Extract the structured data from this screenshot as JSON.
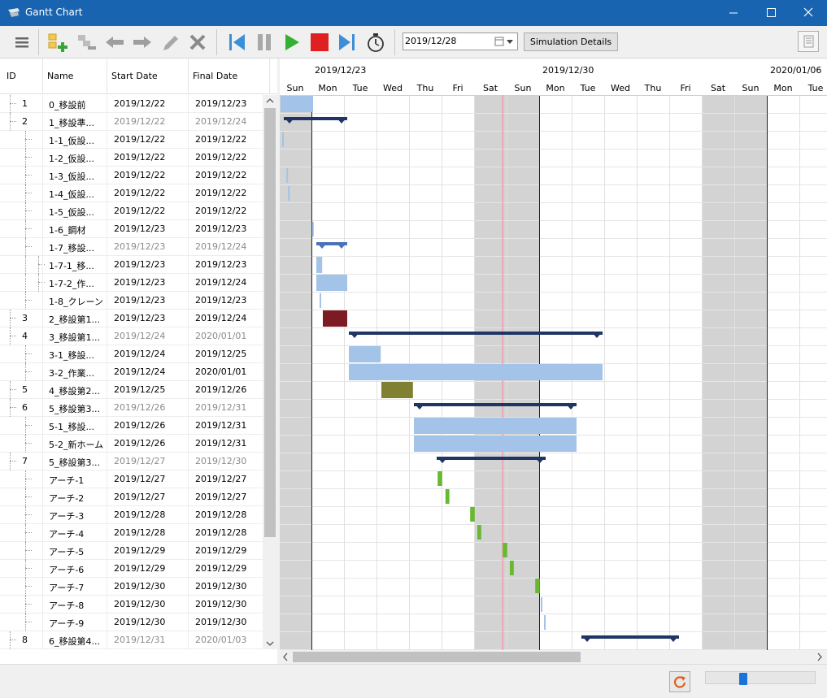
{
  "window": {
    "title": "Gantt Chart",
    "minimize_icon": "minimize-icon",
    "maximize_icon": "maximize-icon",
    "close_icon": "close-icon"
  },
  "toolbar": {
    "menu_icon": "hamburger-menu-icon",
    "add_task_icon": "add-task-icon",
    "add_subtask_icon": "add-subtask-icon",
    "outdent_icon": "arrow-left-icon",
    "indent_icon": "arrow-right-icon",
    "edit_icon": "pencil-icon",
    "delete_icon": "delete-x-icon",
    "skip_start_icon": "skip-to-start-icon",
    "pause_icon": "pause-icon",
    "play_icon": "play-icon",
    "stop_icon": "stop-icon",
    "skip_end_icon": "skip-to-end-icon",
    "timer_icon": "stopwatch-icon",
    "date_value": "2019/12/28",
    "simulation_details_label": "Simulation Details",
    "table_view_icon": "table-view-icon"
  },
  "grid": {
    "headers": {
      "id": "ID",
      "name": "Name",
      "start": "Start Date",
      "final": "Final Date"
    },
    "rows": [
      {
        "id": "1",
        "name": "0_移設前",
        "start": "2019/12/22",
        "final": "2019/12/23",
        "grey": false,
        "level": 0
      },
      {
        "id": "2",
        "name": "1_移設準...",
        "start": "2019/12/22",
        "final": "2019/12/24",
        "grey": true,
        "level": 0
      },
      {
        "id": "",
        "name": "1-1_仮設...",
        "start": "2019/12/22",
        "final": "2019/12/22",
        "grey": false,
        "level": 1
      },
      {
        "id": "",
        "name": "1-2_仮設...",
        "start": "2019/12/22",
        "final": "2019/12/22",
        "grey": false,
        "level": 1
      },
      {
        "id": "",
        "name": "1-3_仮設...",
        "start": "2019/12/22",
        "final": "2019/12/22",
        "grey": false,
        "level": 1
      },
      {
        "id": "",
        "name": "1-4_仮設...",
        "start": "2019/12/22",
        "final": "2019/12/22",
        "grey": false,
        "level": 1
      },
      {
        "id": "",
        "name": "1-5_仮設...",
        "start": "2019/12/22",
        "final": "2019/12/22",
        "grey": false,
        "level": 1
      },
      {
        "id": "",
        "name": "1-6_鋼材",
        "start": "2019/12/23",
        "final": "2019/12/23",
        "grey": false,
        "level": 1
      },
      {
        "id": "",
        "name": "1-7_移設...",
        "start": "2019/12/23",
        "final": "2019/12/24",
        "grey": true,
        "level": 1
      },
      {
        "id": "",
        "name": "1-7-1_移...",
        "start": "2019/12/23",
        "final": "2019/12/23",
        "grey": false,
        "level": 2
      },
      {
        "id": "",
        "name": "1-7-2_作...",
        "start": "2019/12/23",
        "final": "2019/12/24",
        "grey": false,
        "level": 2
      },
      {
        "id": "",
        "name": "1-8_クレーン",
        "start": "2019/12/23",
        "final": "2019/12/23",
        "grey": false,
        "level": 1
      },
      {
        "id": "3",
        "name": "2_移設第1...",
        "start": "2019/12/23",
        "final": "2019/12/24",
        "grey": false,
        "level": 0
      },
      {
        "id": "4",
        "name": "3_移設第1...",
        "start": "2019/12/24",
        "final": "2020/01/01",
        "grey": true,
        "level": 0
      },
      {
        "id": "",
        "name": "3-1_移設...",
        "start": "2019/12/24",
        "final": "2019/12/25",
        "grey": false,
        "level": 1
      },
      {
        "id": "",
        "name": "3-2_作業...",
        "start": "2019/12/24",
        "final": "2020/01/01",
        "grey": false,
        "level": 1
      },
      {
        "id": "5",
        "name": "4_移設第2...",
        "start": "2019/12/25",
        "final": "2019/12/26",
        "grey": false,
        "level": 0
      },
      {
        "id": "6",
        "name": "5_移設第3...",
        "start": "2019/12/26",
        "final": "2019/12/31",
        "grey": true,
        "level": 0
      },
      {
        "id": "",
        "name": "5-1_移設...",
        "start": "2019/12/26",
        "final": "2019/12/31",
        "grey": false,
        "level": 1
      },
      {
        "id": "",
        "name": "5-2_新ホーム",
        "start": "2019/12/26",
        "final": "2019/12/31",
        "grey": false,
        "level": 1
      },
      {
        "id": "7",
        "name": "5_移設第3...",
        "start": "2019/12/27",
        "final": "2019/12/30",
        "grey": true,
        "level": 0
      },
      {
        "id": "",
        "name": "アーチ-1",
        "start": "2019/12/27",
        "final": "2019/12/27",
        "grey": false,
        "level": 1
      },
      {
        "id": "",
        "name": "アーチ-2",
        "start": "2019/12/27",
        "final": "2019/12/27",
        "grey": false,
        "level": 1
      },
      {
        "id": "",
        "name": "アーチ-3",
        "start": "2019/12/28",
        "final": "2019/12/28",
        "grey": false,
        "level": 1
      },
      {
        "id": "",
        "name": "アーチ-4",
        "start": "2019/12/28",
        "final": "2019/12/28",
        "grey": false,
        "level": 1
      },
      {
        "id": "",
        "name": "アーチ-5",
        "start": "2019/12/29",
        "final": "2019/12/29",
        "grey": false,
        "level": 1
      },
      {
        "id": "",
        "name": "アーチ-6",
        "start": "2019/12/29",
        "final": "2019/12/29",
        "grey": false,
        "level": 1
      },
      {
        "id": "",
        "name": "アーチ-7",
        "start": "2019/12/30",
        "final": "2019/12/30",
        "grey": false,
        "level": 1
      },
      {
        "id": "",
        "name": "アーチ-8",
        "start": "2019/12/30",
        "final": "2019/12/30",
        "grey": false,
        "level": 1
      },
      {
        "id": "",
        "name": "アーチ-9",
        "start": "2019/12/30",
        "final": "2019/12/30",
        "grey": false,
        "level": 1
      },
      {
        "id": "8",
        "name": "6_移設第4...",
        "start": "2019/12/31",
        "final": "2020/01/03",
        "grey": true,
        "level": 0
      }
    ]
  },
  "chart": {
    "week_labels": [
      "2019/12/23",
      "2019/12/30",
      "2020/01/06"
    ],
    "day_labels": [
      "Sun",
      "Mon",
      "Tue",
      "Wed",
      "Thu",
      "Fri",
      "Sat",
      "Sun",
      "Mon",
      "Tue",
      "Wed",
      "Thu",
      "Fri",
      "Sat",
      "Sun",
      "Mon",
      "Tue"
    ],
    "current_date": "2019/12/28",
    "colors": {
      "task": "#a3c3e8",
      "summary": "#1f3563",
      "summary_sub": "#4a72b8",
      "milestone_red": "#7c1c22",
      "olive": "#808033",
      "arch": "#68b830",
      "weekend": "#d3d3d3",
      "today_line": "#f2a6b7"
    },
    "bars": [
      {
        "row": 0,
        "type": "task",
        "start": 0.05,
        "end": 1.05
      },
      {
        "row": 1,
        "type": "summary",
        "start": 0.15,
        "end": 2.1
      },
      {
        "row": 2,
        "type": "thin",
        "start": 0.1,
        "end": 0.12
      },
      {
        "row": 4,
        "type": "thin",
        "start": 0.23,
        "end": 0.25
      },
      {
        "row": 5,
        "type": "thin",
        "start": 0.28,
        "end": 0.3
      },
      {
        "row": 7,
        "type": "thin",
        "start": 1.02,
        "end": 1.08
      },
      {
        "row": 8,
        "type": "summary_sub",
        "start": 1.15,
        "end": 2.1
      },
      {
        "row": 9,
        "type": "task",
        "start": 1.15,
        "end": 1.33
      },
      {
        "row": 10,
        "type": "task",
        "start": 1.15,
        "end": 2.1
      },
      {
        "row": 11,
        "type": "thin",
        "start": 1.25,
        "end": 1.28
      },
      {
        "row": 12,
        "type": "milestone_red",
        "start": 1.35,
        "end": 2.1
      },
      {
        "row": 13,
        "type": "summary",
        "start": 2.15,
        "end": 9.95
      },
      {
        "row": 14,
        "type": "task",
        "start": 2.15,
        "end": 3.13
      },
      {
        "row": 15,
        "type": "task",
        "start": 2.15,
        "end": 9.95
      },
      {
        "row": 16,
        "type": "olive",
        "start": 3.15,
        "end": 4.12
      },
      {
        "row": 17,
        "type": "summary",
        "start": 4.15,
        "end": 9.15
      },
      {
        "row": 18,
        "type": "task",
        "start": 4.15,
        "end": 9.15
      },
      {
        "row": 19,
        "type": "task",
        "start": 4.15,
        "end": 9.15
      },
      {
        "row": 20,
        "type": "summary",
        "start": 4.85,
        "end": 8.2
      },
      {
        "row": 21,
        "type": "arch",
        "start": 4.88,
        "end": 5.02
      },
      {
        "row": 22,
        "type": "arch",
        "start": 5.12,
        "end": 5.24
      },
      {
        "row": 23,
        "type": "arch",
        "start": 5.88,
        "end": 6.02
      },
      {
        "row": 24,
        "type": "arch",
        "start": 6.1,
        "end": 6.22
      },
      {
        "row": 25,
        "type": "arch",
        "start": 6.88,
        "end": 7.02
      },
      {
        "row": 26,
        "type": "arch",
        "start": 7.1,
        "end": 7.22
      },
      {
        "row": 27,
        "type": "arch",
        "start": 7.88,
        "end": 8.02
      },
      {
        "row": 28,
        "type": "thin",
        "start": 8.05,
        "end": 8.08
      },
      {
        "row": 29,
        "type": "thin",
        "start": 8.15,
        "end": 8.18
      },
      {
        "row": 30,
        "type": "summary",
        "start": 9.3,
        "end": 12.3
      }
    ]
  },
  "status": {
    "refresh_icon": "refresh-icon",
    "zoom_level": 0.33
  }
}
